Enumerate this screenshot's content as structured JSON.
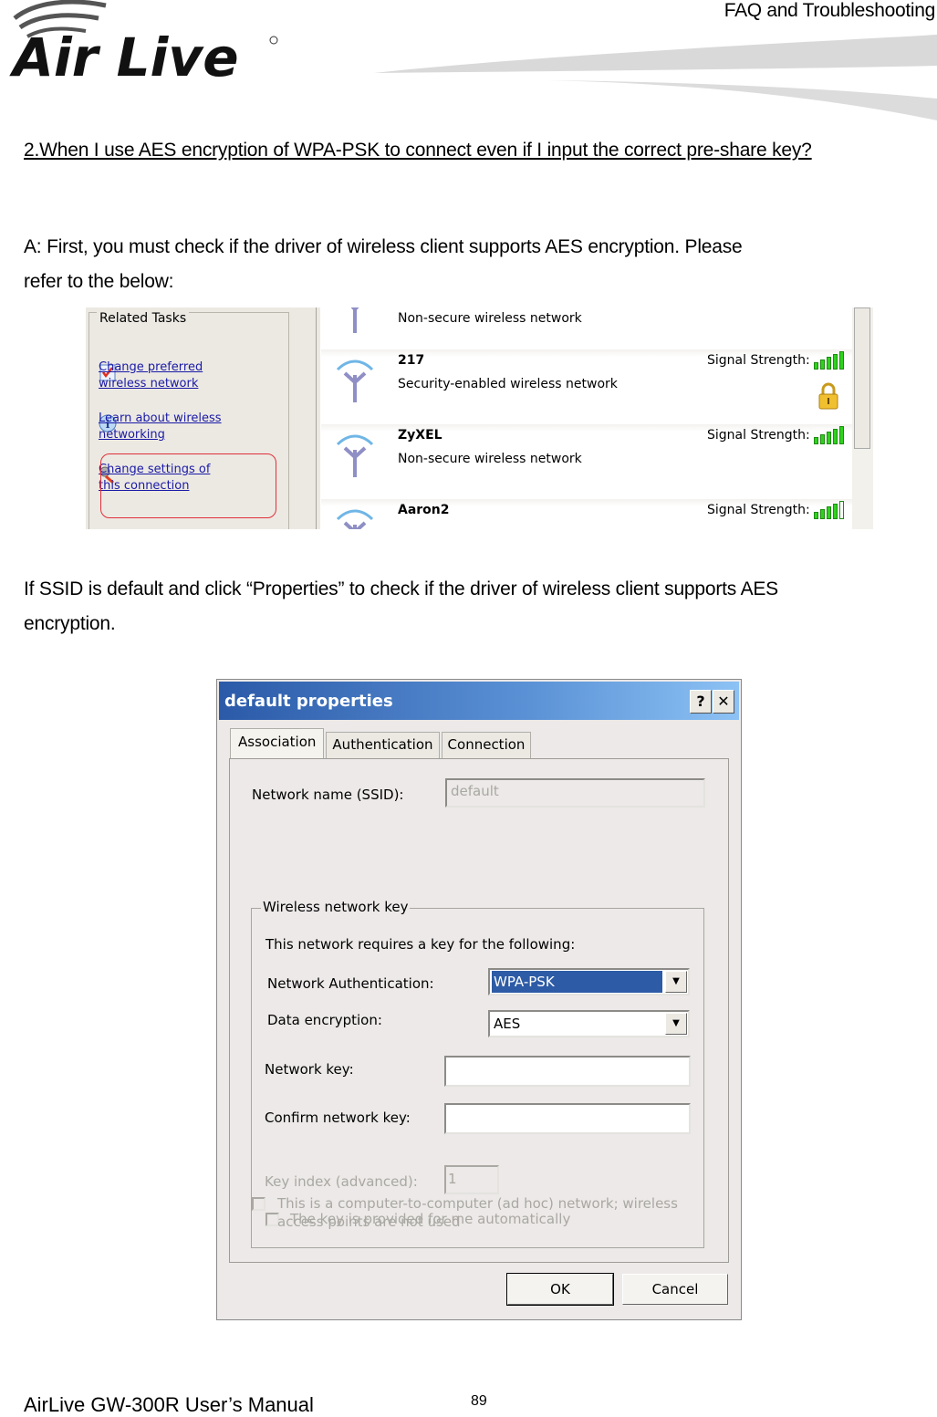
{
  "header": {
    "section_title": "FAQ and Troubleshooting",
    "logo_text": "Air Live"
  },
  "content": {
    "question": "2.When I use AES encryption of WPA-PSK to connect even if I input the correct pre-share key?",
    "answer_line1": "A: First, you must check if the driver of wireless client supports AES encryption. Please",
    "answer_line2": "refer to the below:",
    "instruction_line1": "If SSID is default and click “Properties” to check if the driver of wireless client supports AES",
    "instruction_line2": "encryption."
  },
  "wireless_screenshot": {
    "related_tasks_title": "Related Tasks",
    "tasks": [
      {
        "label": "Change preferred wireless network",
        "icon": "checklist-icon"
      },
      {
        "label": "Learn about wireless networking",
        "icon": "info-icon"
      },
      {
        "label": "Change settings of this connection",
        "icon": "settings-wrench-icon",
        "highlighted": true
      }
    ],
    "networks": [
      {
        "name": "",
        "description": "Non-secure wireless network",
        "signal_label": "",
        "signal_bars": null,
        "secured": false
      },
      {
        "name": "217",
        "description": "Security-enabled wireless network",
        "signal_label": "Signal Strength:",
        "signal_bars": 5,
        "secured": true
      },
      {
        "name": "ZyXEL",
        "description": "Non-secure wireless network",
        "signal_label": "Signal Strength:",
        "signal_bars": 5,
        "secured": false
      },
      {
        "name": "Aaron2",
        "description": "",
        "signal_label": "Signal Strength:",
        "signal_bars": 4,
        "secured": false
      }
    ],
    "max_signal_bars": 5
  },
  "dialog": {
    "title": "default properties",
    "help_button": "?",
    "close_button": "✕",
    "tabs": [
      "Association",
      "Authentication",
      "Connection"
    ],
    "active_tab": "Association",
    "ssid_label": "Network name (SSID):",
    "ssid_value": "default",
    "group_title": "Wireless network key",
    "requires_text": "This network requires a key for the following:",
    "auth_label": "Network Authentication:",
    "auth_value": "WPA-PSK",
    "enc_label": "Data encryption:",
    "enc_value": "AES",
    "key_label": "Network key:",
    "key_value": "",
    "confirm_label": "Confirm network key:",
    "confirm_value": "",
    "key_index_label": "Key index (advanced):",
    "key_index_value": "1",
    "auto_key_label": "The key is provided for me automatically",
    "adhoc_label_line1": "This is a computer-to-computer (ad hoc) network; wireless",
    "adhoc_label_line2": "access points are not used",
    "ok_label": "OK",
    "cancel_label": "Cancel"
  },
  "footer": {
    "manual_title": "AirLive GW-300R User’s Manual",
    "page_number": "89"
  }
}
